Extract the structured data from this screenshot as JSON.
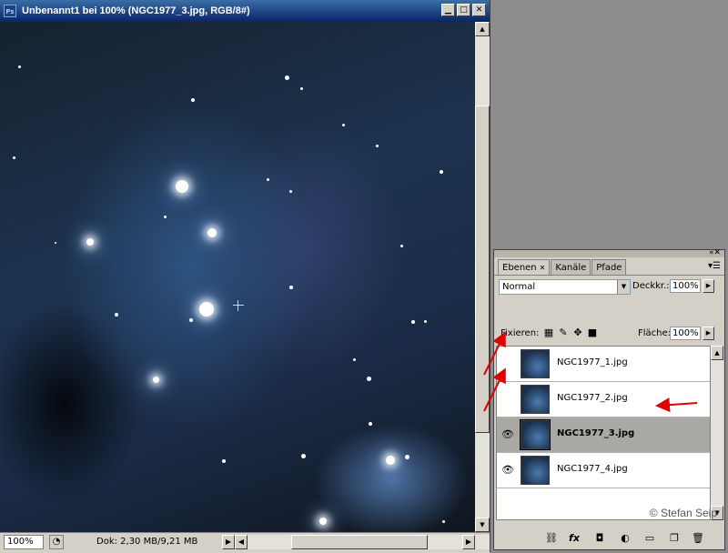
{
  "window": {
    "app_icon_text": "Ps",
    "title": "Unbenannt1 bei 100% (NGC1977_3.jpg, RGB/8#)",
    "min_glyph": "▁",
    "max_glyph": "□",
    "close_glyph": "✕"
  },
  "status": {
    "zoom": "100%",
    "doc_info": "Dok: 2,30 MB/9,21 MB"
  },
  "panel": {
    "tabs": [
      {
        "label": "Ebenen",
        "close": "✕"
      },
      {
        "label": "Kanäle"
      },
      {
        "label": "Pfade"
      }
    ],
    "blend_mode": "Normal",
    "opacity_label": "Deckkr.:",
    "opacity_value": "100%",
    "lock_label": "Fixieren:",
    "fill_label": "Fläche:",
    "fill_value": "100%",
    "layers": [
      {
        "name": "NGC1977_1.jpg",
        "visible": false,
        "selected": false
      },
      {
        "name": "NGC1977_2.jpg",
        "visible": false,
        "selected": false
      },
      {
        "name": "NGC1977_3.jpg",
        "visible": true,
        "selected": true
      },
      {
        "name": "NGC1977_4.jpg",
        "visible": true,
        "selected": false
      }
    ],
    "copyright": "© Stefan Seip"
  },
  "icons": {
    "eye": "👁",
    "annotation_color": "#e00000"
  }
}
